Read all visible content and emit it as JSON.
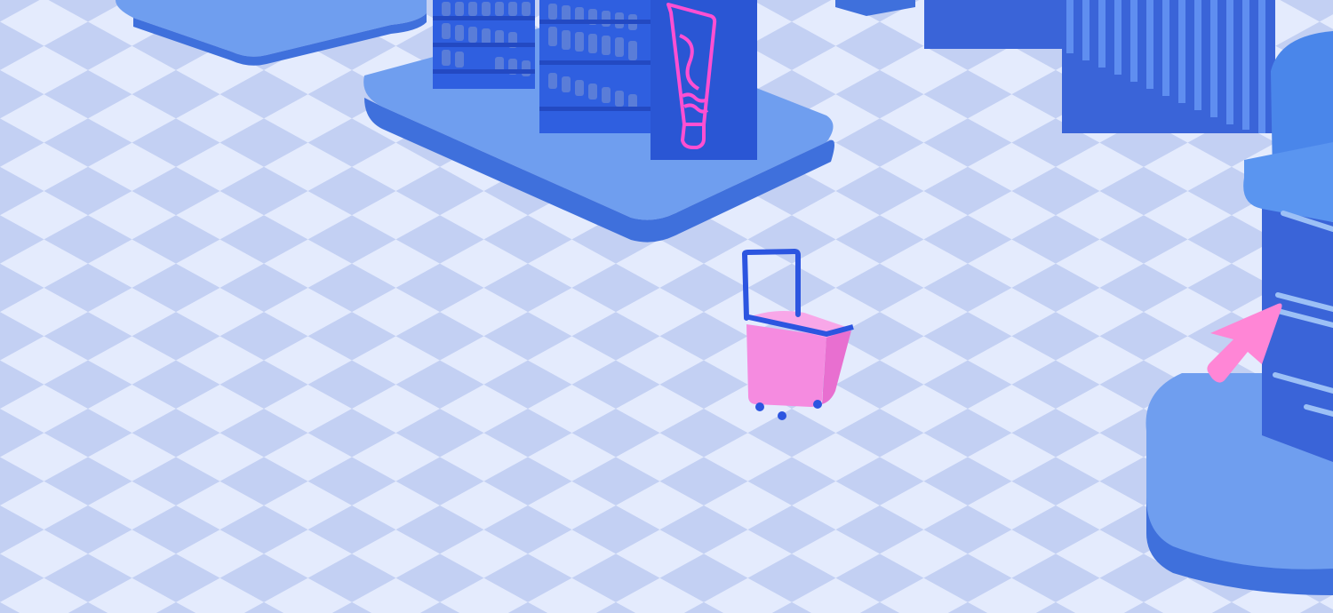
{
  "scene": {
    "description_free": true,
    "palette": {
      "floor_light": "#e4ebfd",
      "floor_dark": "#c3d0f3",
      "platform": "#6f9eef",
      "platform_side": "#3f70dc",
      "shelf": "#2f5fe0",
      "shelf_dark": "#2349c2",
      "product": "#5a7dd8",
      "neon_pink": "#ff4fd2",
      "basket_pink": "#f58be0",
      "basket_handle": "#2c55e0",
      "wall": "#3a64d8",
      "booth": "#4a86ea",
      "cursor": "#ff86d6"
    },
    "icons": [
      "shopping-basket-icon",
      "cursor-arrow-icon",
      "neon-tube-sign-icon"
    ]
  }
}
